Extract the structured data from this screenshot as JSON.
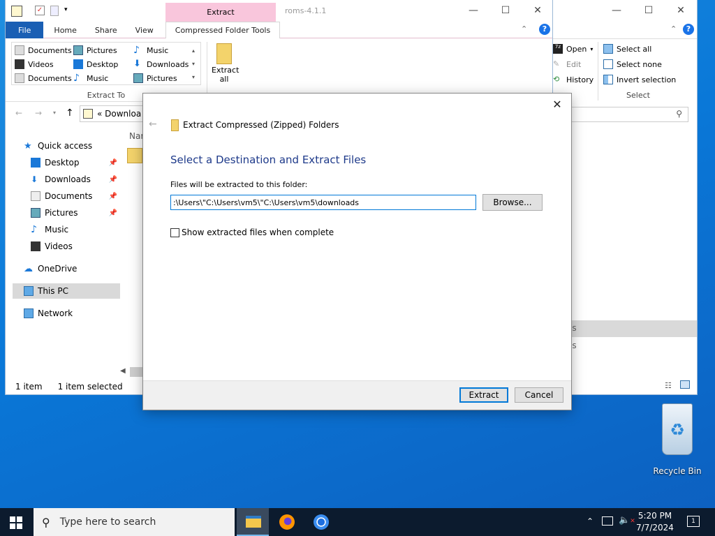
{
  "explorer_back": {
    "title": "roms-4.1.1",
    "tab_context": "Extract",
    "tabs": [
      "File",
      "Home",
      "Share",
      "View",
      "Compressed Folder Tools"
    ],
    "extract_to_col1": [
      "Documents",
      "Videos",
      "Documents"
    ],
    "extract_to_col2": [
      "Pictures",
      "Desktop",
      "Music"
    ],
    "extract_to_col3": [
      "Music",
      "Downloads",
      "Pictures"
    ],
    "extract_to_label": "Extract To",
    "extract_all": "Extract all",
    "address": "«  Downloa",
    "name_header": "Nam",
    "nav": {
      "quick_access": "Quick access",
      "items": [
        "Desktop",
        "Downloads",
        "Documents",
        "Pictures",
        "Music",
        "Videos"
      ],
      "onedrive": "OneDrive",
      "this_pc": "This PC",
      "network": "Network"
    },
    "status_items": "1 item",
    "status_selected": "1 item selected"
  },
  "explorer_front": {
    "open": "Open",
    "edit": "Edit",
    "history": "History",
    "select_all": "Select all",
    "select_none": "Select none",
    "invert": "Invert selection",
    "select_label": "Select",
    "frag1": "ls",
    "frag2": "ls"
  },
  "dialog": {
    "header": "Extract Compressed (Zipped) Folders",
    "heading": "Select a Destination and Extract Files",
    "path_label": "Files will be extracted to this folder:",
    "path_value": ":\\Users\\\"C:\\Users\\vm5\\\"C:\\Users\\vm5\\downloads",
    "browse": "Browse...",
    "checkbox_label": "Show extracted files when complete",
    "extract": "Extract",
    "cancel": "Cancel"
  },
  "desktop": {
    "recycle_bin": "Recycle Bin"
  },
  "taskbar": {
    "search_placeholder": "Type here to search",
    "time": "5:20 PM",
    "date": "7/7/2024",
    "notification_count": "1"
  },
  "colors": {
    "accent": "#0078d7",
    "heading": "#1e3a8a",
    "file_tab": "#1a5fb4",
    "context_tab": "#f9c6dc"
  }
}
